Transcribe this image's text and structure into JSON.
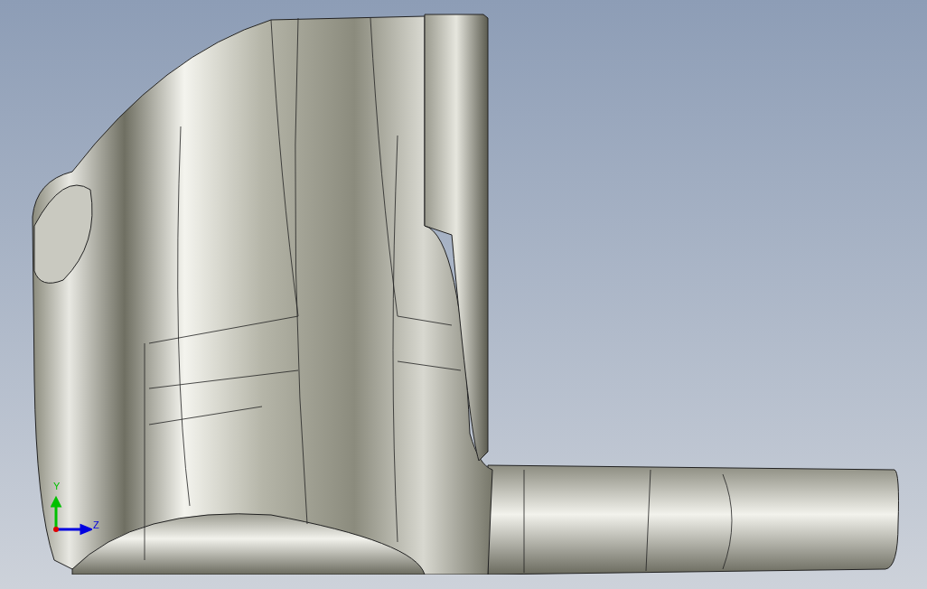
{
  "viewport": {
    "triad": {
      "axes": [
        {
          "label": "Y",
          "color": "#00c000"
        },
        {
          "label": "Z",
          "color": "#0000e0"
        }
      ]
    }
  }
}
